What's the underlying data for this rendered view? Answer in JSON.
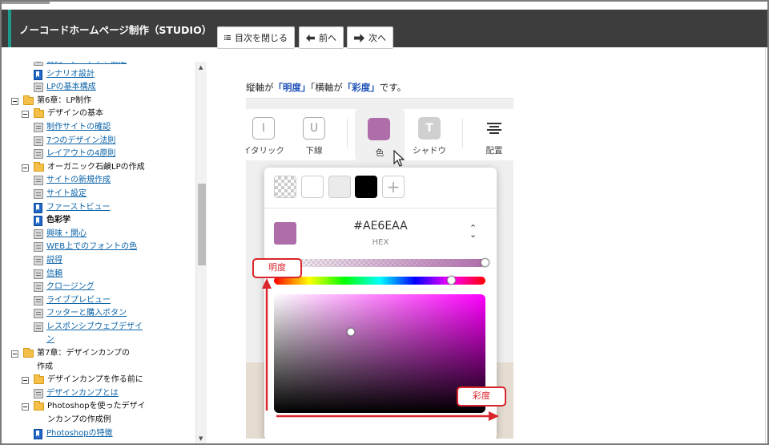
{
  "header": {
    "title": "ノーコードホームページ制作（STUDIO）",
    "toc_button": "目次を閉じる",
    "prev_button": "前へ",
    "next_button": "次へ"
  },
  "toc": {
    "items": [
      {
        "label": "目的・ターゲット設定",
        "type": "page",
        "link": true
      },
      {
        "label": "シナリオ設計",
        "type": "bookmark",
        "link": true
      },
      {
        "label": "LPの基本構成",
        "type": "page",
        "link": true
      },
      {
        "label": "第6章：LP制作",
        "type": "folder"
      },
      {
        "label": "デザインの基本",
        "type": "folder"
      },
      {
        "label": "制作サイトの確認",
        "type": "page",
        "link": true
      },
      {
        "label": "7つのデザイン法則",
        "type": "page",
        "link": true
      },
      {
        "label": "レイアウトの4原則",
        "type": "page",
        "link": true
      },
      {
        "label": "オーガニック石鹸LPの作成",
        "type": "folder"
      },
      {
        "label": "サイトの新規作成",
        "type": "page",
        "link": true
      },
      {
        "label": "サイト設定",
        "type": "page",
        "link": true
      },
      {
        "label": "ファーストビュー",
        "type": "bookmark",
        "link": true
      },
      {
        "label": "色彩学",
        "type": "bookmark",
        "current": true
      },
      {
        "label": "興味・関心",
        "type": "page",
        "link": true
      },
      {
        "label": "WEB上でのフォントの色",
        "type": "page",
        "link": true
      },
      {
        "label": "説得",
        "type": "page",
        "link": true
      },
      {
        "label": "信頼",
        "type": "page",
        "link": true
      },
      {
        "label": "クロージング",
        "type": "page",
        "link": true
      },
      {
        "label": "ライブプレビュー",
        "type": "page",
        "link": true
      },
      {
        "label": "フッターと購入ボタン",
        "type": "page",
        "link": true
      },
      {
        "label": "レスポンシブウェブデザイ",
        "type": "page",
        "link": true
      },
      {
        "label": "ン",
        "type": "cont",
        "link": true
      },
      {
        "label": "第7章：デザインカンプの",
        "type": "folder"
      },
      {
        "label": "作成",
        "type": "cont"
      },
      {
        "label": "デザインカンプを作る前に",
        "type": "folder"
      },
      {
        "label": "デザインカンプとは",
        "type": "page",
        "link": true
      },
      {
        "label": "Photoshopを使ったデザイ",
        "type": "folder"
      },
      {
        "label": "ンカンプの作成例",
        "type": "cont"
      },
      {
        "label": "Photoshopの特徴",
        "type": "bookmark",
        "link": true
      }
    ]
  },
  "content": {
    "desc_pre": "縦軸が",
    "desc_h1": "「明度」",
    "desc_mid": "「横軸が",
    "desc_h2": "「彩度」",
    "desc_post": "です。",
    "format_bar": {
      "italic_label": "イタリック",
      "underline_label": "下線",
      "color_label": "色",
      "shadow_label": "シャドウ",
      "align_label": "配置",
      "italic_glyph": "I",
      "underline_glyph": "U",
      "shadow_glyph": "T"
    },
    "color_picker": {
      "hex_value": "#AE6EAA",
      "hex_label": "HEX",
      "current_color": "#AE6EAA",
      "preset_colors": [
        "transparent",
        "#FFFFFF",
        "#EBEBEB",
        "#000000"
      ],
      "alpha": 1.0,
      "hue": 0.84,
      "plus_glyph": "+"
    },
    "annotations": {
      "brightness": "明度",
      "saturation": "彩度",
      "color": "#D9252B"
    }
  }
}
